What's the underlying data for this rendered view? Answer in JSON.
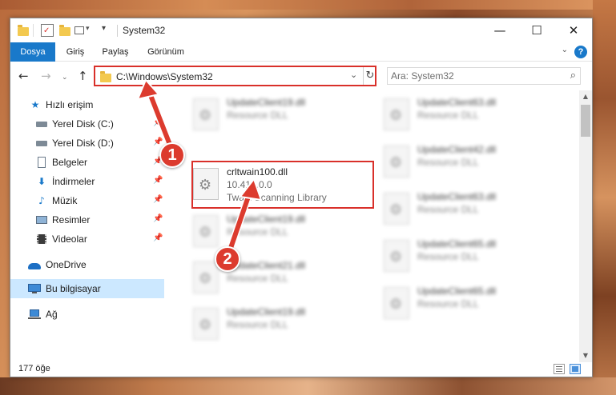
{
  "window": {
    "title": "System32",
    "controls": {
      "minimize": "—",
      "maximize": "☐",
      "close": "✕"
    }
  },
  "ribbon": {
    "tabs": [
      {
        "label": "Dosya",
        "active": true
      },
      {
        "label": "Giriş"
      },
      {
        "label": "Paylaş"
      },
      {
        "label": "Görünüm"
      }
    ],
    "help": "?"
  },
  "navigation": {
    "address_path": "C:\\Windows\\System32",
    "search_placeholder": "Ara: System32"
  },
  "sidebar": {
    "items": [
      {
        "label": "Hızlı erişim",
        "icon": "star-icon",
        "pinned": false
      },
      {
        "label": "Yerel Disk (C:)",
        "icon": "drive-icon",
        "pinned": true
      },
      {
        "label": "Yerel Disk (D:)",
        "icon": "drive-icon",
        "pinned": true
      },
      {
        "label": "Belgeler",
        "icon": "document-icon",
        "pinned": true
      },
      {
        "label": "İndirmeler",
        "icon": "download-icon",
        "pinned": true
      },
      {
        "label": "Müzik",
        "icon": "music-icon",
        "pinned": true
      },
      {
        "label": "Resimler",
        "icon": "picture-icon",
        "pinned": true
      },
      {
        "label": "Videolar",
        "icon": "video-icon",
        "pinned": true
      },
      {
        "label": "OneDrive",
        "icon": "cloud-icon",
        "pinned": false
      },
      {
        "label": "Bu bilgisayar",
        "icon": "computer-icon",
        "pinned": false,
        "selected": true
      },
      {
        "label": "Ağ",
        "icon": "network-icon",
        "pinned": false
      }
    ]
  },
  "files": {
    "left_column": [
      {
        "name": "UpdateClient19.dll",
        "line2": "Resource DLL",
        "line3": "",
        "blurred": true
      },
      {
        "name": "crltwain100.dll",
        "line2": "10.410.0.0",
        "line3": "Twain Scanning Library",
        "blurred": false,
        "highlighted": true
      },
      {
        "name": "UpdateClient19.dll",
        "line2": "Resource DLL",
        "line3": "",
        "blurred": true
      },
      {
        "name": "UpdateClient21.dll",
        "line2": "Resource DLL",
        "line3": "",
        "blurred": true
      },
      {
        "name": "UpdateClient19.dll",
        "line2": "Resource DLL",
        "line3": "",
        "blurred": true
      }
    ],
    "right_column": [
      {
        "name": "UpdateClient63.dll",
        "line2": "Resource DLL",
        "blurred": true
      },
      {
        "name": "UpdateClient42.dll",
        "line2": "Resource DLL",
        "blurred": true
      },
      {
        "name": "UpdateClient63.dll",
        "line2": "Resource DLL",
        "blurred": true
      },
      {
        "name": "UpdateClient65.dll",
        "line2": "Resource DLL",
        "blurred": true
      },
      {
        "name": "UpdateClient65.dll",
        "line2": "Resource DLL",
        "blurred": true
      }
    ]
  },
  "status": {
    "item_count": "177 öğe"
  },
  "annotations": {
    "badge1": "1",
    "badge2": "2",
    "accent": "#dc3b2e"
  }
}
